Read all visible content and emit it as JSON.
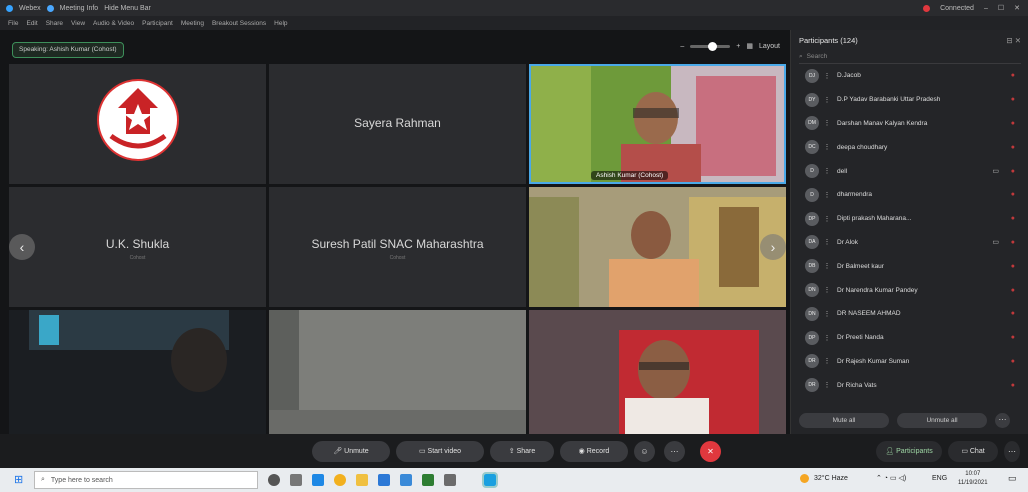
{
  "titlebar": {
    "app": "Webex",
    "meeting_info": "Meeting Info",
    "hide_menu": "Hide Menu Bar",
    "connected": "Connected"
  },
  "menubar": {
    "items": [
      "File",
      "Edit",
      "Share",
      "View",
      "Audio & Video",
      "Participant",
      "Meeting",
      "Breakout Sessions",
      "Help"
    ]
  },
  "stage": {
    "speaking_label": "Speaking: Ashish Kumar (Cohost)",
    "layout_label": "Layout",
    "tiles": [
      {
        "name": "",
        "sub": ""
      },
      {
        "name": "Sayera Rahman",
        "sub": ""
      },
      {
        "name": "",
        "sub": "",
        "video_label": "Ashish Kumar (Cohost)"
      },
      {
        "name": "U.K. Shukla",
        "sub": "Cohost"
      },
      {
        "name": "Suresh Patil SNAC Maharashtra",
        "sub": "Cohost"
      }
    ]
  },
  "panel": {
    "title": "Participants (124)",
    "search_placeholder": "Search",
    "participants": [
      {
        "initials": "DJ",
        "name": "D.Jacob"
      },
      {
        "initials": "DY",
        "name": "D.P Yadav Barabanki Uttar Pradesh"
      },
      {
        "initials": "DM",
        "name": "Darshan Manav Kalyan Kendra"
      },
      {
        "initials": "DC",
        "name": "deepa choudhary"
      },
      {
        "initials": "D",
        "name": "dell"
      },
      {
        "initials": "D",
        "name": "dharmendra"
      },
      {
        "initials": "DP",
        "name": "Dipti prakash Maharana..."
      },
      {
        "initials": "DA",
        "name": "Dr Alok"
      },
      {
        "initials": "DB",
        "name": "Dr Balmeet kaur"
      },
      {
        "initials": "DN",
        "name": "Dr Narendra Kumar Pandey"
      },
      {
        "initials": "DN",
        "name": "DR NASEEM AHMAD"
      },
      {
        "initials": "DP",
        "name": "Dr Preeti Nanda"
      },
      {
        "initials": "DR",
        "name": "Dr Rajesh Kumar Suman"
      },
      {
        "initials": "DR",
        "name": "Dr Richa Vats"
      }
    ],
    "mute_all": "Mute all",
    "unmute_all": "Unmute all"
  },
  "controls": {
    "unmute": "Unmute",
    "start_video": "Start video",
    "share": "Share",
    "record": "Record",
    "participants": "Participants",
    "chat": "Chat"
  },
  "taskbar": {
    "search_placeholder": "Type here to search",
    "weather": "32°C Haze",
    "lang": "ENG",
    "time": "10:07",
    "date": "11/19/2021"
  }
}
